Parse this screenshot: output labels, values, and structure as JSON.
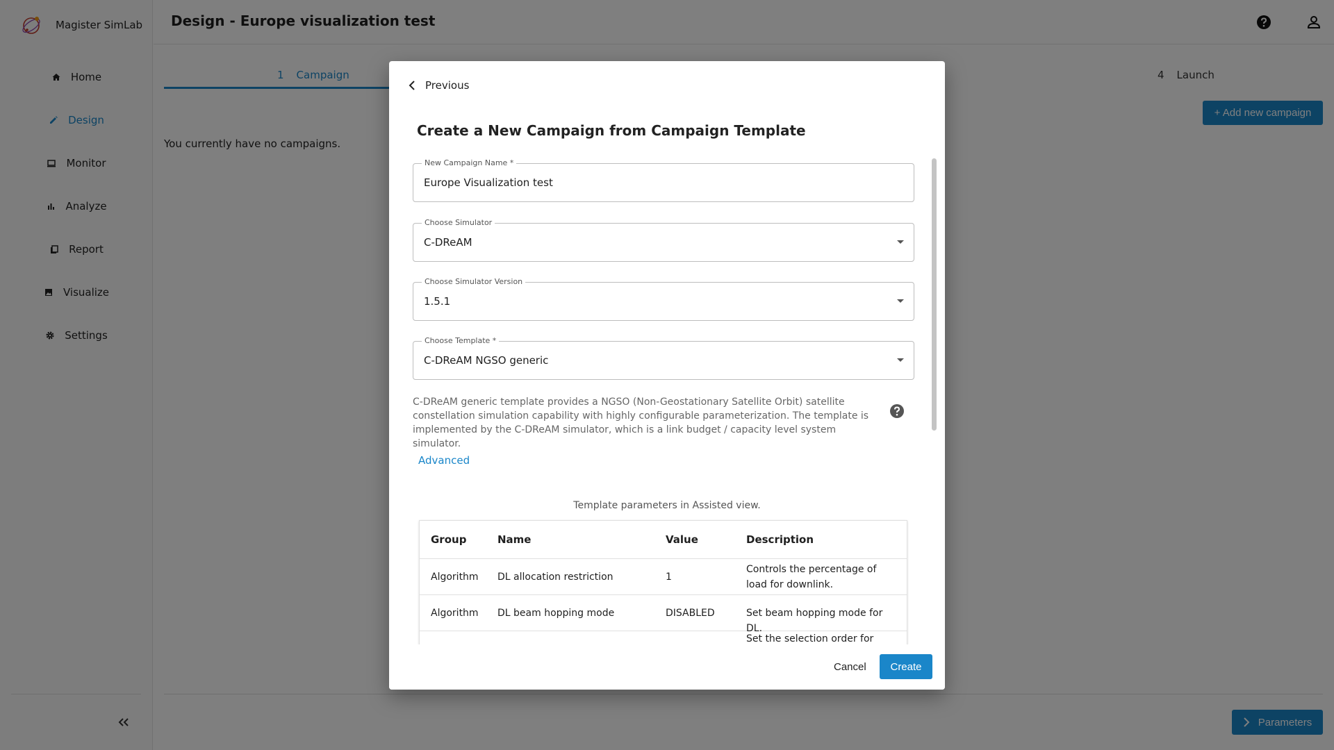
{
  "app": {
    "name": "Magister SimLab"
  },
  "sidebar": {
    "items": [
      {
        "label": "Home",
        "icon": "home-icon"
      },
      {
        "label": "Design",
        "icon": "pencil-icon",
        "active": true
      },
      {
        "label": "Monitor",
        "icon": "monitor-icon"
      },
      {
        "label": "Analyze",
        "icon": "bar-chart-icon"
      },
      {
        "label": "Report",
        "icon": "report-icon"
      },
      {
        "label": "Visualize",
        "icon": "image-icon"
      },
      {
        "label": "Settings",
        "icon": "gear-icon"
      }
    ]
  },
  "header": {
    "title": "Design - Europe visualization test"
  },
  "stepper": {
    "steps": [
      {
        "number": "1",
        "label": "Campaign",
        "active": true
      },
      {
        "number": "4",
        "label": "Launch"
      }
    ]
  },
  "main": {
    "add_campaign_label": "+ Add new campaign",
    "empty_message": "You currently have no campaigns.",
    "parameters_label": "Parameters"
  },
  "modal": {
    "previous_label": "Previous",
    "title": "Create a New Campaign from Campaign Template",
    "fields": {
      "campaign_name": {
        "label": "New Campaign Name *",
        "value": "Europe Visualization test"
      },
      "simulator": {
        "label": "Choose Simulator",
        "value": "C-DReAM"
      },
      "simulator_version": {
        "label": "Choose Simulator Version",
        "value": "1.5.1"
      },
      "template": {
        "label": "Choose Template *",
        "value": "C-DReAM NGSO generic"
      }
    },
    "template_description": "C-DReAM generic template provides a NGSO (Non-Geostationary Satellite Orbit) satellite constellation simulation capability with highly configurable parameterization. The template is implemented by the C-DReAM simulator, which is a link budget / capacity level system simulator.",
    "advanced_label": "Advanced",
    "table_caption": "Template parameters in Assisted view.",
    "table": {
      "headers": {
        "group": "Group",
        "name": "Name",
        "value": "Value",
        "description": "Description"
      },
      "rows": [
        {
          "group": "Algorithm",
          "name": "DL allocation restriction",
          "value": "1",
          "description": "Controls the percentage of load for downlink."
        },
        {
          "group": "Algorithm",
          "name": "DL beam hopping mode",
          "value": "DISABLED",
          "description": "Set beam hopping mode for DL."
        },
        {
          "group": "",
          "name": "",
          "value": "",
          "description": "Set the selection order for"
        }
      ]
    },
    "cancel_label": "Cancel",
    "create_label": "Create"
  },
  "colors": {
    "accent": "#1a86c9",
    "overlay": "rgba(0,0,0,0.5)"
  }
}
